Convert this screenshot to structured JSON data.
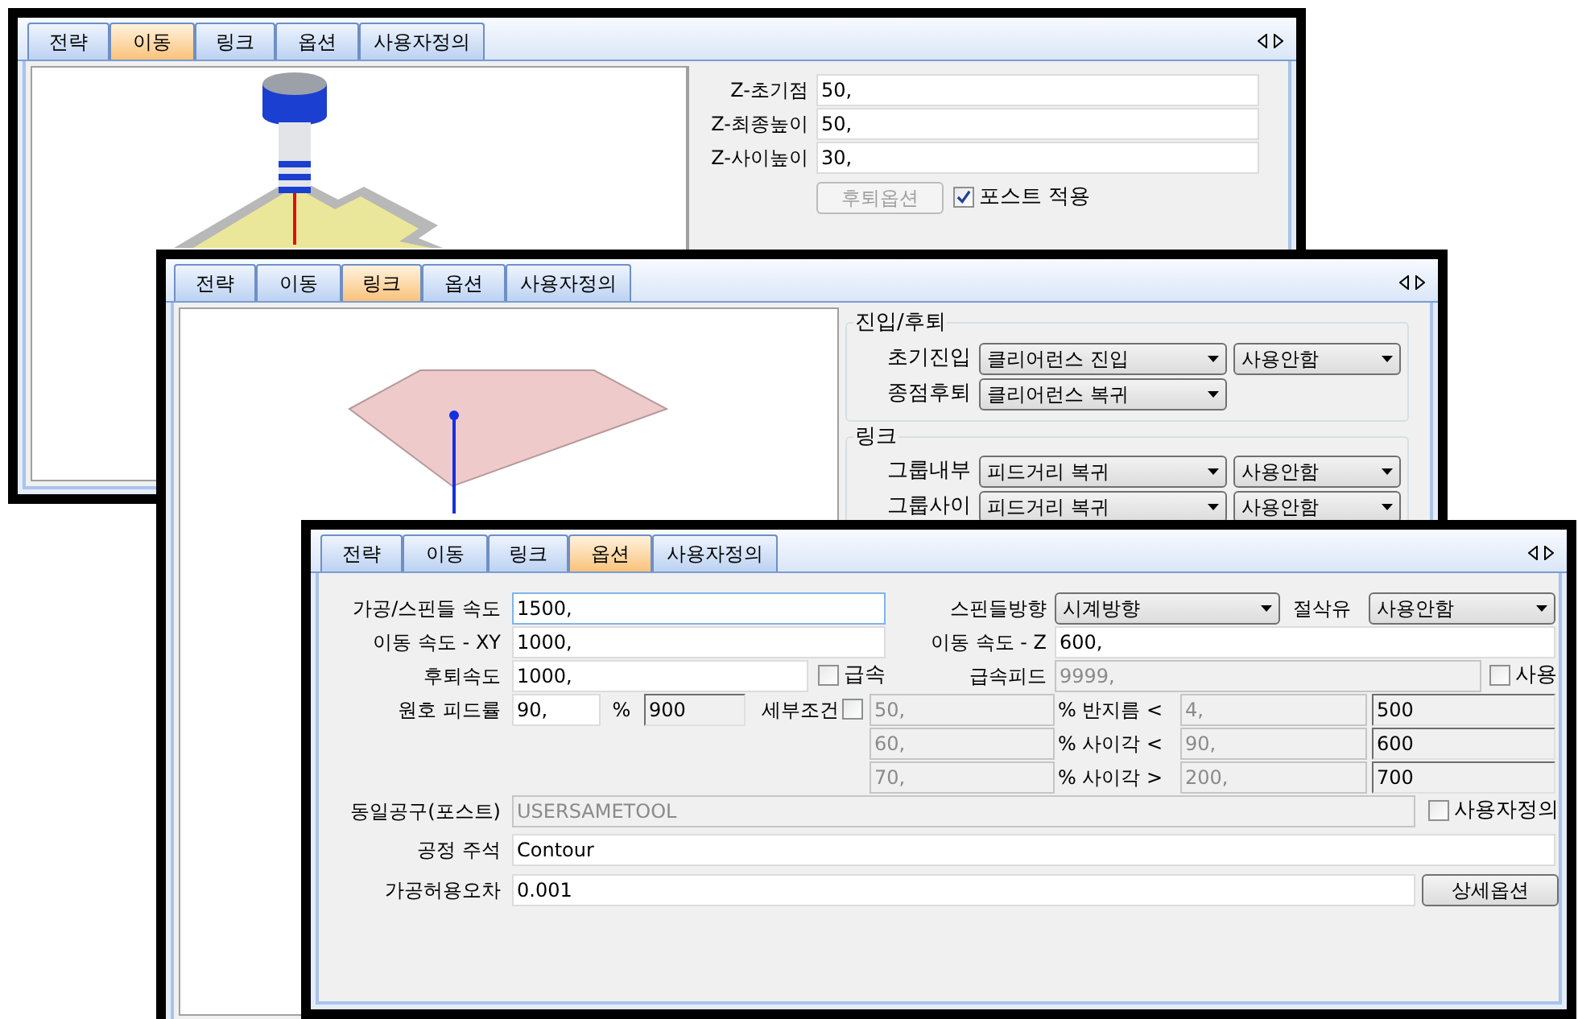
{
  "windows": [
    {
      "kind": "move",
      "tabs": [
        {
          "label": "전략",
          "selected": false
        },
        {
          "label": "이동",
          "selected": true
        },
        {
          "label": "링크",
          "selected": false
        },
        {
          "label": "옵션",
          "selected": false
        },
        {
          "label": "사용자정의",
          "selected": false
        }
      ],
      "fields": [
        {
          "label": "Z-초기점",
          "value": "50,"
        },
        {
          "label": "Z-최종높이",
          "value": "50,"
        },
        {
          "label": "Z-사이높이",
          "value": "30,"
        }
      ],
      "retract_button": {
        "label": "후퇴옵션",
        "disabled": true
      },
      "post_checkbox": {
        "label": "포스트 적용",
        "checked": true
      }
    },
    {
      "kind": "link",
      "tabs": [
        {
          "label": "전략",
          "selected": false
        },
        {
          "label": "이동",
          "selected": false
        },
        {
          "label": "링크",
          "selected": true
        },
        {
          "label": "옵션",
          "selected": false
        },
        {
          "label": "사용자정의",
          "selected": false
        }
      ],
      "groups": [
        {
          "title": "진입/후퇴",
          "rows": [
            {
              "label": "초기진입",
              "selects": [
                "클리어런스 진입",
                "사용안함"
              ]
            },
            {
              "label": "종점후퇴",
              "selects": [
                "클리어런스 복귀"
              ]
            }
          ]
        },
        {
          "title": "링크",
          "rows": [
            {
              "label": "그룹내부",
              "selects": [
                "피드거리 복귀",
                "사용안함"
              ]
            },
            {
              "label": "그룹사이",
              "selects": [
                "피드거리 복귀",
                "사용안함"
              ]
            }
          ]
        }
      ]
    },
    {
      "kind": "options",
      "tabs": [
        {
          "label": "전략",
          "selected": false
        },
        {
          "label": "이동",
          "selected": false
        },
        {
          "label": "링크",
          "selected": false
        },
        {
          "label": "옵션",
          "selected": true
        },
        {
          "label": "사용자정의",
          "selected": false
        }
      ],
      "form_lines": [
        {
          "items": [
            {
              "kind": "label",
              "text": "가공/스핀들 속도"
            },
            {
              "kind": "input",
              "value": "1500,",
              "disabled": false,
              "focused": true
            },
            {
              "kind": "label",
              "text": "스핀들방향"
            },
            {
              "kind": "select",
              "value": "시계방향"
            },
            {
              "kind": "label",
              "text": "절삭유"
            },
            {
              "kind": "select",
              "value": "사용안함"
            }
          ]
        },
        {
          "items": [
            {
              "kind": "label",
              "text": "이동 속도 - XY"
            },
            {
              "kind": "input",
              "value": "1000,",
              "disabled": false,
              "focused": false
            },
            {
              "kind": "label",
              "text": "이동 속도 - Z"
            },
            {
              "kind": "input",
              "value": "600,",
              "disabled": false,
              "focused": false
            }
          ]
        },
        {
          "items": [
            {
              "kind": "label",
              "text": "후퇴속도"
            },
            {
              "kind": "input",
              "value": "1000,",
              "disabled": false,
              "focused": false
            },
            {
              "kind": "checkbox",
              "label": "급속",
              "checked": false
            },
            {
              "kind": "label",
              "text": "급속피드"
            },
            {
              "kind": "input",
              "value": "9999,",
              "disabled": true
            },
            {
              "kind": "checkbox",
              "label": "사용",
              "checked": false
            }
          ]
        },
        {
          "items": [
            {
              "kind": "label",
              "text": "원호 피드률"
            },
            {
              "kind": "input",
              "value": "90,",
              "disabled": false,
              "focused": false
            },
            {
              "kind": "label",
              "text": "%"
            },
            {
              "kind": "display",
              "value": "900"
            },
            {
              "kind": "label",
              "text": "세부조건"
            },
            {
              "kind": "checkbox",
              "checked": false
            },
            {
              "kind": "input",
              "value": "50,",
              "disabled": true
            },
            {
              "kind": "label",
              "text": "% 반지름 <"
            },
            {
              "kind": "input",
              "value": "4,",
              "disabled": true
            },
            {
              "kind": "display",
              "value": "500"
            }
          ]
        },
        {
          "items": [
            {
              "kind": "input",
              "value": "60,",
              "disabled": true
            },
            {
              "kind": "label",
              "text": "% 사이각 <"
            },
            {
              "kind": "input",
              "value": "90,",
              "disabled": true
            },
            {
              "kind": "display",
              "value": "600"
            }
          ]
        },
        {
          "items": [
            {
              "kind": "input",
              "value": "70,",
              "disabled": true
            },
            {
              "kind": "label",
              "text": "% 사이각 >"
            },
            {
              "kind": "input",
              "value": "200,",
              "disabled": true
            },
            {
              "kind": "display",
              "value": "700"
            }
          ]
        },
        {
          "items": [
            {
              "kind": "label",
              "text": "동일공구(포스트)"
            },
            {
              "kind": "input",
              "value": "USERSAMETOOL",
              "disabled": true
            },
            {
              "kind": "checkbox",
              "label": "사용자정의",
              "checked": false
            }
          ]
        },
        {
          "items": [
            {
              "kind": "label",
              "text": "공정 주석"
            },
            {
              "kind": "input",
              "value": "Contour",
              "disabled": false,
              "focused": false
            }
          ]
        },
        {
          "items": [
            {
              "kind": "label",
              "text": "가공허용오차"
            },
            {
              "kind": "input",
              "value": "0.001",
              "disabled": false,
              "focused": false
            },
            {
              "kind": "button",
              "label": "상세옵션"
            }
          ]
        }
      ]
    }
  ]
}
